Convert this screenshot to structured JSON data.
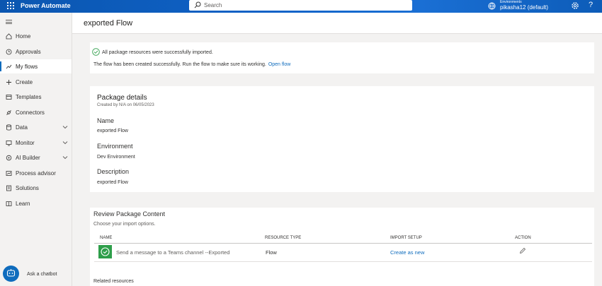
{
  "app": {
    "title": "Power Automate"
  },
  "search": {
    "placeholder": "Search"
  },
  "environment": {
    "label": "Environments",
    "name": "pikasha12 (default)"
  },
  "icons": {
    "top": [
      "app-launcher-icon",
      "search-icon",
      "environment-icon",
      "gear-icon",
      "help-icon"
    ],
    "nav": [
      "home-icon",
      "approvals-icon",
      "flows-icon",
      "plus-icon",
      "templates-icon",
      "connectors-icon",
      "data-icon",
      "monitor-icon",
      "ai-builder-icon",
      "process-advisor-icon",
      "solutions-icon",
      "learn-icon"
    ]
  },
  "sidebar": {
    "items": [
      {
        "label": "Home",
        "expandable": false,
        "active": false
      },
      {
        "label": "Approvals",
        "expandable": false,
        "active": false
      },
      {
        "label": "My flows",
        "expandable": false,
        "active": true
      },
      {
        "label": "Create",
        "expandable": false,
        "active": false
      },
      {
        "label": "Templates",
        "expandable": false,
        "active": false
      },
      {
        "label": "Connectors",
        "expandable": false,
        "active": false
      },
      {
        "label": "Data",
        "expandable": true,
        "active": false
      },
      {
        "label": "Monitor",
        "expandable": true,
        "active": false
      },
      {
        "label": "AI Builder",
        "expandable": true,
        "active": false
      },
      {
        "label": "Process advisor",
        "expandable": false,
        "active": false
      },
      {
        "label": "Solutions",
        "expandable": false,
        "active": false
      },
      {
        "label": "Learn",
        "expandable": false,
        "active": false
      }
    ],
    "chatbot_label": "Ask a chatbot"
  },
  "page": {
    "title": "exported Flow",
    "success_message": "All package resources were successfully imported.",
    "created_message": "The flow has been created successfully. Run the flow to make sure its working.",
    "open_link": "Open flow"
  },
  "package": {
    "title": "Package details",
    "created_by": "Created by N/A on 06/05/2023",
    "name_label": "Name",
    "name_value": "exported Flow",
    "environment_label": "Environment",
    "environment_value": "Dev Environment",
    "description_label": "Description",
    "description_value": "exported Flow"
  },
  "review": {
    "title": "Review Package Content",
    "subtitle": "Choose your import options.",
    "columns": [
      "NAME",
      "RESOURCE TYPE",
      "IMPORT SETUP",
      "ACTION"
    ],
    "rows": [
      {
        "name": "Send a message to a Teams channel --Exported",
        "type": "Flow",
        "setup": "Create as new"
      }
    ],
    "related_label": "Related resources"
  },
  "colors": {
    "accent": "#0f6cbd",
    "topbar": "#0f62c7",
    "success": "#2e9e4a"
  }
}
